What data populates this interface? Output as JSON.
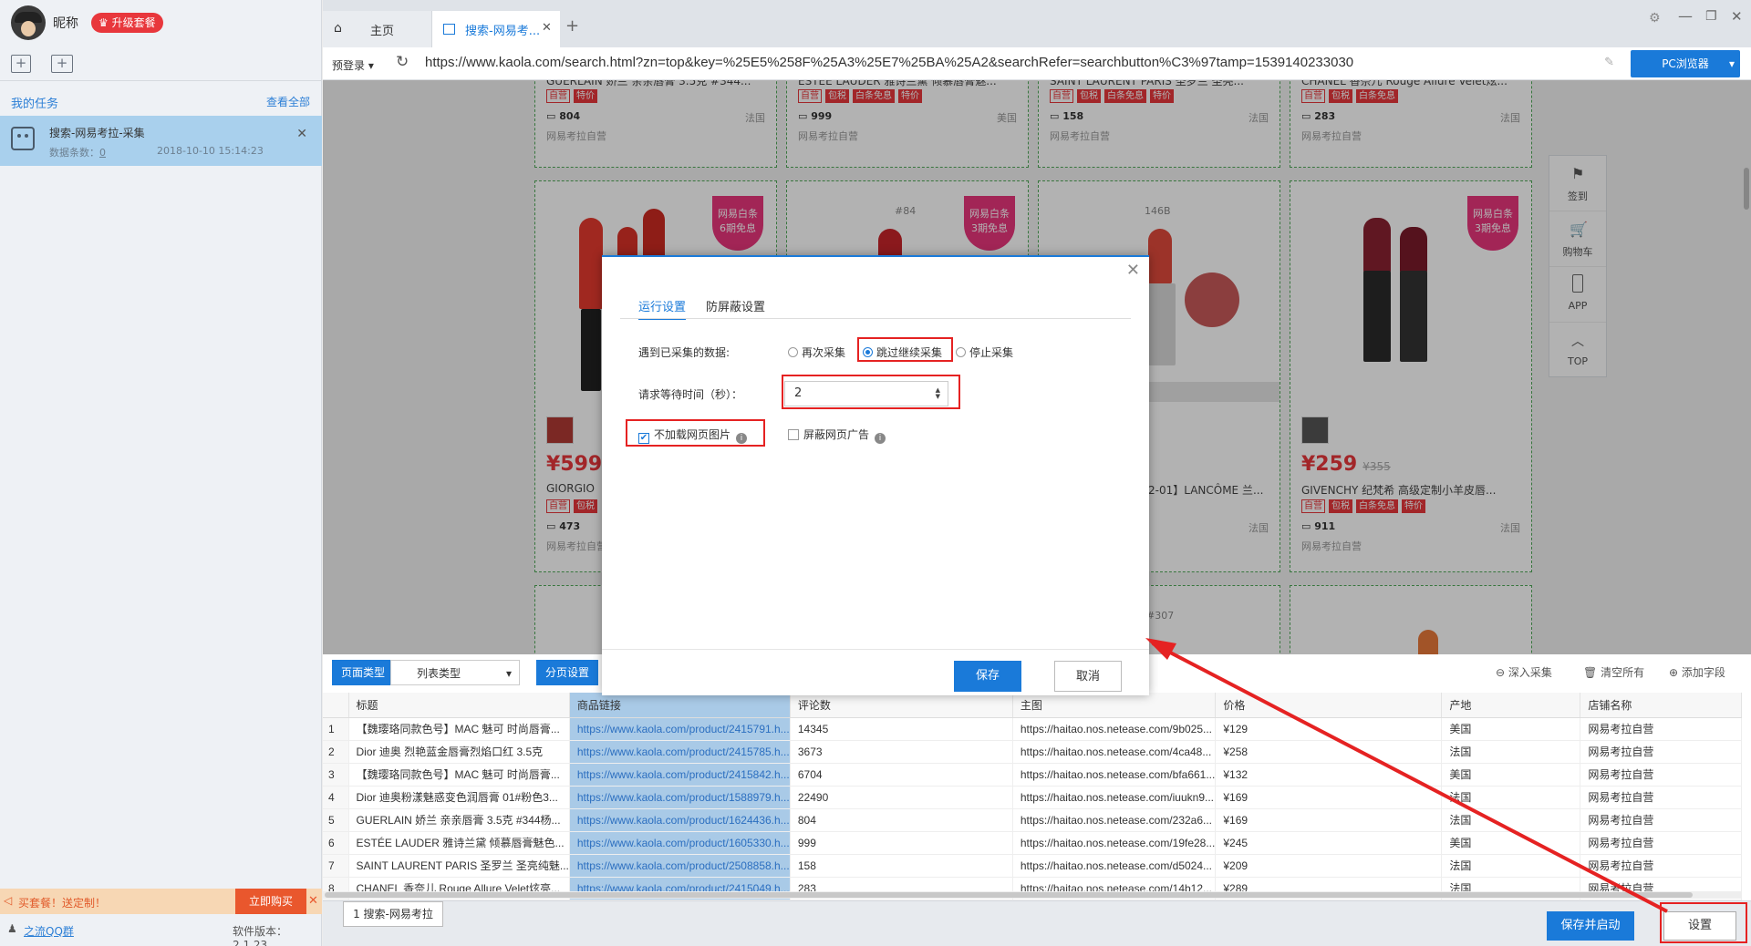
{
  "user": {
    "nickname": "昵称",
    "upgrade_label": "升级套餐"
  },
  "sidebar": {
    "my_tasks": "我的任务",
    "view_all": "查看全部",
    "task": {
      "title": "搜索-网易考拉-采集",
      "count_label": "数据条数：",
      "count": "0",
      "date": "2018-10-10 15:14:23"
    },
    "promo_text": "买套餐！送定制！",
    "buy_now": "立即购买",
    "qq_group": "之流QQ群",
    "version": "软件版本：2.1.23"
  },
  "tabs": [
    {
      "label": "主页"
    },
    {
      "label": "搜索-网易考..."
    }
  ],
  "address_bar": {
    "prelogin": "预登录",
    "url": "https://www.kaola.com/search.html?zn=top&key=%25E5%258F%25A3%25E7%25BA%25A2&searchRefer=searchbutton%C3%97tamp=1539140233030",
    "pc_browser": "PC浏览器"
  },
  "products_row1": [
    {
      "title": "GUERLAIN 娇兰 亲亲唇膏 3.5克 #344...",
      "tags": [
        "自营",
        "特价"
      ],
      "comments": "804",
      "origin": "法国",
      "shop": "网易考拉自营"
    },
    {
      "title": "ESTÉE LAUDER 雅诗兰黛 倾慕唇膏魅...",
      "tags": [
        "自营",
        "包税",
        "白条免息",
        "特价"
      ],
      "comments": "999",
      "origin": "美国",
      "shop": "网易考拉自营"
    },
    {
      "title": "SAINT LAURENT PARIS 圣罗兰 圣亮...",
      "tags": [
        "自营",
        "包税",
        "白条免息",
        "特价"
      ],
      "comments": "158",
      "origin": "法国",
      "shop": "网易考拉自营"
    },
    {
      "title": "CHANEL 香奈儿 Rouge Allure Velet炫...",
      "tags": [
        "自营",
        "包税",
        "白条免息"
      ],
      "comments": "283",
      "origin": "法国",
      "shop": "网易考拉自营"
    }
  ],
  "products_row2": [
    {
      "badge": "网易白条\n6期免息",
      "price": "¥599",
      "title": "GIORGIO",
      "tags": [
        "自营",
        "包税"
      ],
      "comments": "473",
      "shop": "网易考拉自营"
    },
    {
      "badge": "网易白条\n3期免息",
      "code": "#84"
    },
    {
      "code": "146B",
      "title": "2-01】LANCÔME 兰...",
      "origin": "法国"
    },
    {
      "badge": "网易白条\n3期免息",
      "price": "¥259",
      "old_price": "¥355",
      "title": "GIVENCHY 纪梵希 高级定制小羊皮唇...",
      "tags": [
        "自营",
        "包税",
        "白条免息",
        "特价"
      ],
      "comments": "911",
      "origin": "法国",
      "shop": "网易考拉自营"
    }
  ],
  "row3_code": "#307",
  "float_bar": [
    {
      "label": "签到",
      "icon": "flag-icon"
    },
    {
      "label": "购物车",
      "icon": "cart-icon"
    },
    {
      "label": "APP",
      "icon": "phone-icon"
    },
    {
      "label": "TOP",
      "icon": "chevron-up-icon"
    }
  ],
  "dialog": {
    "tabs": [
      "运行设置",
      "防屏蔽设置"
    ],
    "collected_label": "遇到已采集的数据:",
    "radio_options": [
      "再次采集",
      "跳过继续采集",
      "停止采集"
    ],
    "radio_selected": "跳过继续采集",
    "wait_label": "请求等待时间（秒）：",
    "wait_value": "2",
    "no_images_label": "不加载网页图片",
    "no_images_checked": true,
    "block_ads_label": "屏蔽网页广告",
    "block_ads_checked": false,
    "save": "保存",
    "cancel": "取消"
  },
  "panel_toolbar": {
    "page_type": "页面类型",
    "list_type": "列表类型",
    "pagination": "分页设置",
    "deep_collect": "深入采集",
    "clear_all": "清空所有",
    "add_field": "添加字段"
  },
  "table": {
    "columns": [
      "标题",
      "商品链接",
      "评论数",
      "主图",
      "价格",
      "产地",
      "店铺名称"
    ],
    "rows": [
      [
        "1",
        "【魏璎珞同款色号】MAC 魅可 时尚唇膏...",
        "https://www.kaola.com/product/2415791.h...",
        "14345",
        "https://haitao.nos.netease.com/9b025...",
        "¥129",
        "美国",
        "网易考拉自营"
      ],
      [
        "2",
        "Dior 迪奥 烈艳蓝金唇膏烈焰口红 3.5克",
        "https://www.kaola.com/product/2415785.h...",
        "3673",
        "https://haitao.nos.netease.com/4ca48...",
        "¥258",
        "法国",
        "网易考拉自营"
      ],
      [
        "3",
        "【魏璎珞同款色号】MAC 魅可 时尚唇膏...",
        "https://www.kaola.com/product/2415842.h...",
        "6704",
        "https://haitao.nos.netease.com/bfa661...",
        "¥132",
        "美国",
        "网易考拉自营"
      ],
      [
        "4",
        "Dior 迪奥粉漾魅惑变色润唇膏 01#粉色3...",
        "https://www.kaola.com/product/1588979.h...",
        "22490",
        "https://haitao.nos.netease.com/iuukn9...",
        "¥169",
        "法国",
        "网易考拉自营"
      ],
      [
        "5",
        "GUERLAIN 娇兰 亲亲唇膏 3.5克 #344杨...",
        "https://www.kaola.com/product/1624436.h...",
        "804",
        "https://haitao.nos.netease.com/232a6...",
        "¥169",
        "法国",
        "网易考拉自营"
      ],
      [
        "6",
        "ESTÉE LAUDER 雅诗兰黛 倾慕唇膏魅色...",
        "https://www.kaola.com/product/1605330.h...",
        "999",
        "https://haitao.nos.netease.com/19fe28...",
        "¥245",
        "美国",
        "网易考拉自营"
      ],
      [
        "7",
        "SAINT LAURENT PARIS 圣罗兰 圣亮纯魅...",
        "https://www.kaola.com/product/2508858.h...",
        "158",
        "https://haitao.nos.netease.com/d5024...",
        "¥209",
        "法国",
        "网易考拉自营"
      ],
      [
        "8",
        "CHANEL 香奈儿 Rouge Allure Velet炫亮...",
        "https://www.kaola.com/product/2415049.h...",
        "283",
        "https://haitao.nos.netease.com/14b12...",
        "¥289",
        "法国",
        "网易考拉自营"
      ]
    ]
  },
  "footer": {
    "tab": "1 搜索-网易考拉",
    "save_start": "保存并启动",
    "settings": "设置"
  },
  "colors": {
    "accent": "#1a7ad9",
    "highlight": "#e52222",
    "brand_red": "#e8373c"
  }
}
